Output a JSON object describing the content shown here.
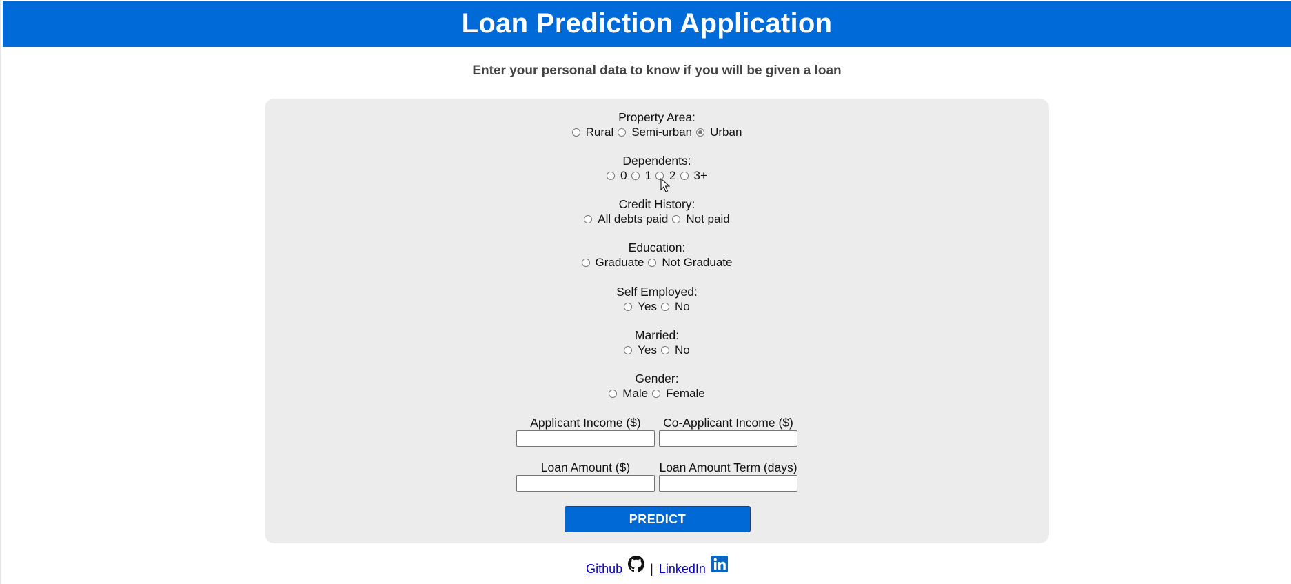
{
  "header": {
    "title": "Loan Prediction Application"
  },
  "subtitle": "Enter your personal data to know if you will be given a loan",
  "form": {
    "property_area": {
      "label": "Property Area:",
      "options": [
        "Rural",
        "Semi-urban",
        "Urban"
      ],
      "selected": "Urban"
    },
    "dependents": {
      "label": "Dependents:",
      "options": [
        "0",
        "1",
        "2",
        "3+"
      ],
      "selected": null
    },
    "credit_history": {
      "label": "Credit History:",
      "options": [
        "All debts paid",
        "Not paid"
      ],
      "selected": null
    },
    "education": {
      "label": "Education:",
      "options": [
        "Graduate",
        "Not Graduate"
      ],
      "selected": null
    },
    "self_employed": {
      "label": "Self Employed:",
      "options": [
        "Yes",
        "No"
      ],
      "selected": null
    },
    "married": {
      "label": "Married:",
      "options": [
        "Yes",
        "No"
      ],
      "selected": null
    },
    "gender": {
      "label": "Gender:",
      "options": [
        "Male",
        "Female"
      ],
      "selected": null
    },
    "applicant_income": {
      "label": "Applicant Income ($)",
      "value": ""
    },
    "coapplicant_income": {
      "label": "Co-Applicant Income ($)",
      "value": ""
    },
    "loan_amount": {
      "label": "Loan Amount ($)",
      "value": ""
    },
    "loan_amount_term": {
      "label": "Loan Amount Term (days)",
      "value": ""
    },
    "predict_label": "PREDICT"
  },
  "footer": {
    "github_label": "Github",
    "separator": "|",
    "linkedin_label": "LinkedIn"
  },
  "colors": {
    "header_bg": "#006ad9",
    "card_bg": "#ececec",
    "button_bg": "#0069d6"
  }
}
